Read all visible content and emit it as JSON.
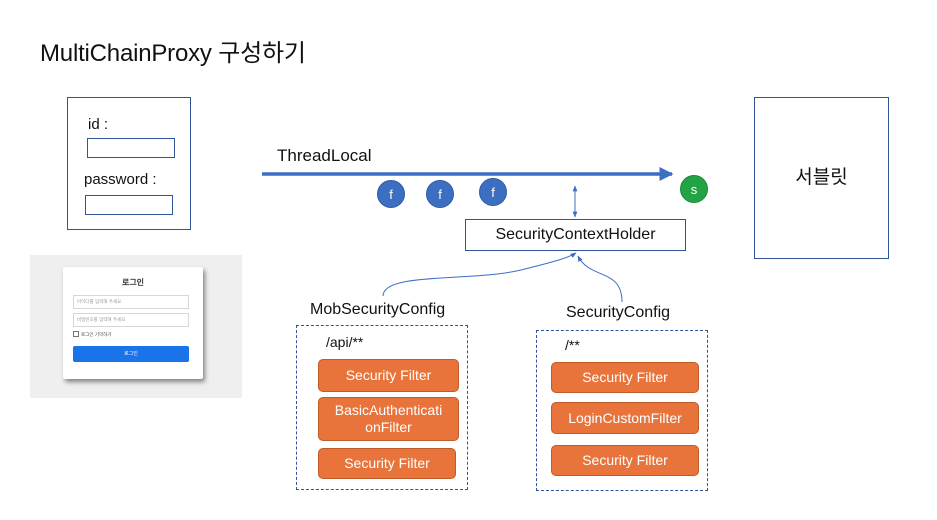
{
  "title": "MultiChainProxy 구성하기",
  "login_form": {
    "id_label": "id :",
    "password_label": "password :"
  },
  "login_screenshot": {
    "heading": "로그인",
    "id_placeholder": "아이디를 입력해 주세요.",
    "password_placeholder": "비밀번호를 입력해 주세요",
    "remember_label": "로그인 기억하기",
    "button_label": "로그인"
  },
  "thread": {
    "label": "ThreadLocal",
    "filter_badges": [
      "f",
      "f",
      "f"
    ],
    "servlet_badge": "s",
    "colors": {
      "line": "#3c6ec2",
      "filter": "#3c6ec2",
      "servlet": "#22a346"
    }
  },
  "security_context_holder": "SecurityContextHolder",
  "servlet": "서블릿",
  "configs": [
    {
      "name": "MobSecurityConfig",
      "pattern": "/api/**",
      "filters": [
        "Security Filter",
        "BasicAuthenticati onFilter",
        "Security Filter"
      ]
    },
    {
      "name": "SecurityConfig",
      "pattern": "/**",
      "filters": [
        "Security Filter",
        "LoginCustomFilter",
        "Security Filter"
      ]
    }
  ],
  "colors": {
    "filter_fill": "#e8743b",
    "outline": "#2f5597"
  }
}
